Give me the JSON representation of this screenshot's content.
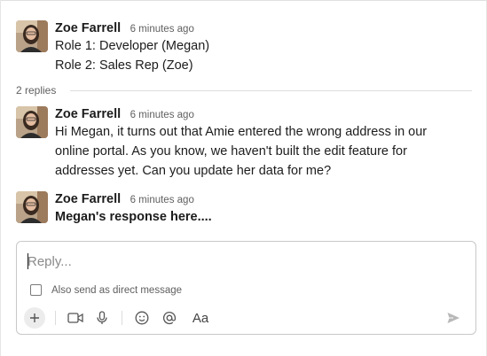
{
  "messages": [
    {
      "author": "Zoe Farrell",
      "time": "6 minutes ago",
      "lines": [
        "Role 1: Developer (Megan)",
        "Role 2: Sales Rep (Zoe)"
      ]
    },
    {
      "author": "Zoe Farrell",
      "time": "6 minutes ago",
      "lines": [
        "Hi Megan, it turns out that Amie entered the wrong address in our",
        "online portal. As you know, we haven't built the edit feature for",
        "addresses yet. Can you update her data for me?"
      ]
    },
    {
      "author": "Zoe Farrell",
      "time": "6 minutes ago",
      "lines": [
        "Megan's response here...."
      ]
    }
  ],
  "thread": {
    "replies_label": "2 replies"
  },
  "composer": {
    "placeholder": "Reply...",
    "dm_checkbox_label": "Also send as direct message",
    "dm_checked": false,
    "tools": [
      "plus-icon",
      "video-icon",
      "microphone-icon",
      "emoji-icon",
      "mention-icon",
      "formatting-icon",
      "send-icon"
    ],
    "formatting_label": "Aa"
  },
  "colors": {
    "text": "#1d1c1d",
    "muted": "#616061",
    "border": "#c8c8c8"
  }
}
